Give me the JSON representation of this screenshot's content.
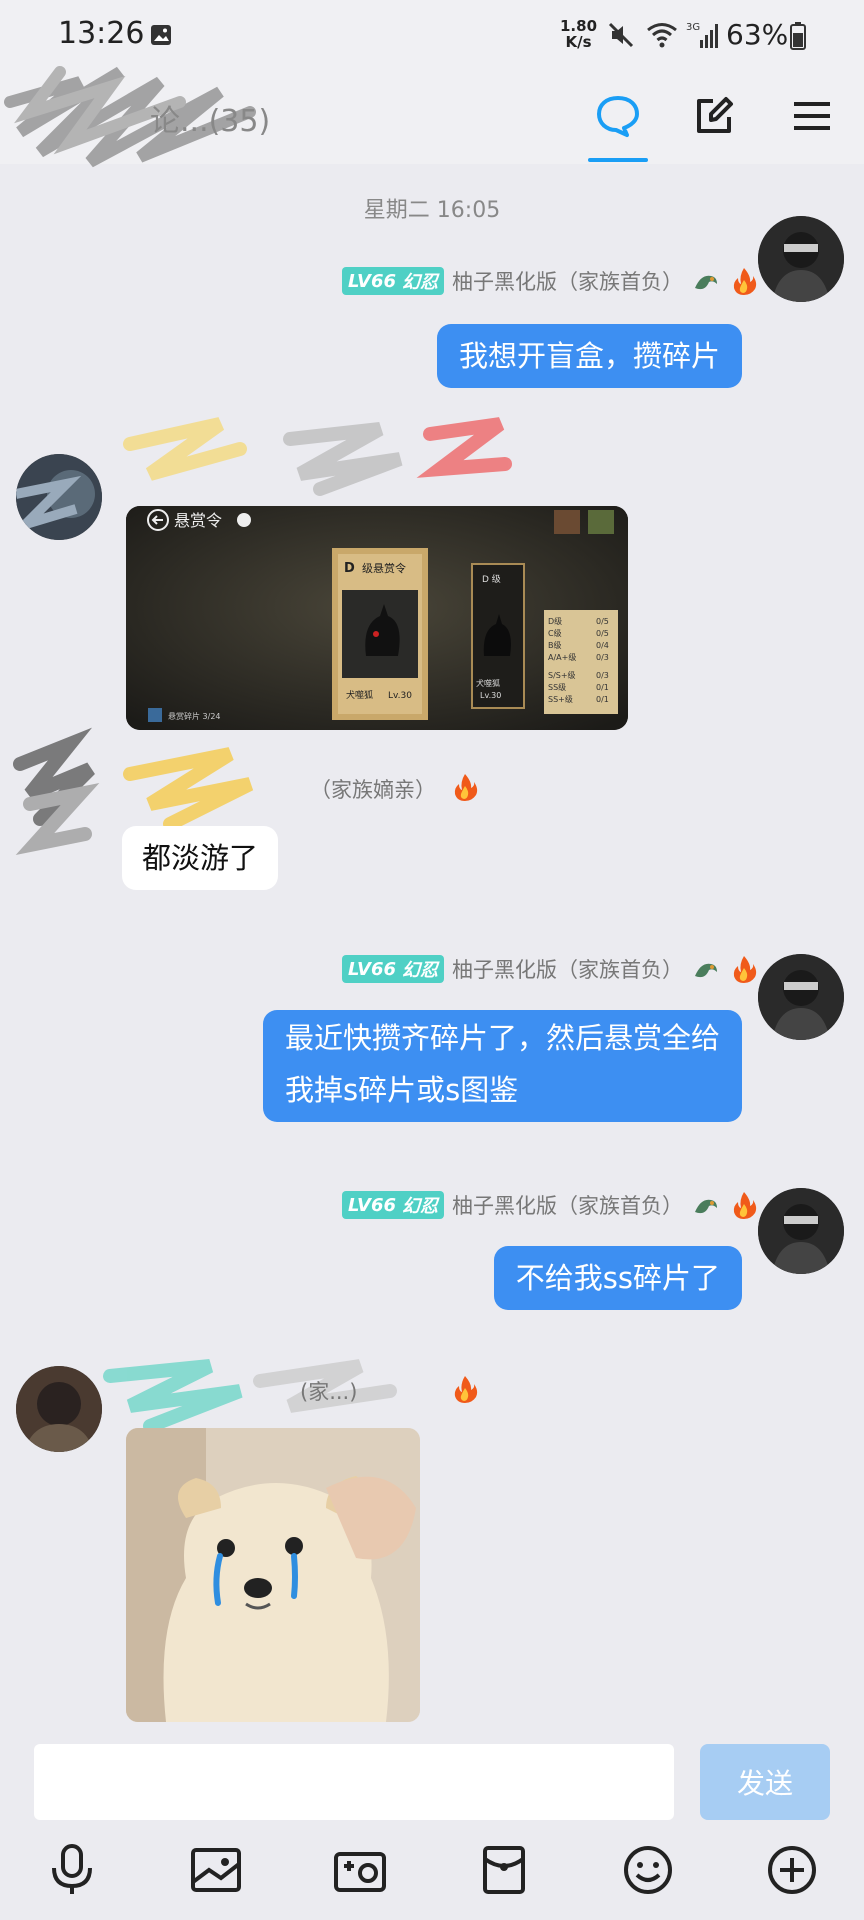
{
  "status_bar": {
    "time": "13:26",
    "net_speed_value": "1.80",
    "net_speed_unit": "K/s",
    "signal_label": "3G",
    "battery": "63%"
  },
  "title_bar": {
    "title": "论...(35)",
    "active_tab": "chat"
  },
  "chat": {
    "timestamp": "星期二 16:05",
    "messages": [
      {
        "side": "right",
        "level": "LV66",
        "rank": "幻忍",
        "sender": "柚子黑化版（家族首负）",
        "text": "我想开盲盒，攒碎片"
      },
      {
        "side": "left",
        "type": "image",
        "image": {
          "title": "悬赏令",
          "card_grade": "D",
          "card_title": "级悬赏令",
          "card_name": "犬噬狐",
          "card_level": "Lv.30",
          "small_card_grade": "D 级",
          "small_card_name": "犬噬狐",
          "small_card_level": "Lv.30",
          "table": [
            {
              "label": "D级",
              "value": "0/5"
            },
            {
              "label": "C级",
              "value": "0/5"
            },
            {
              "label": "B级",
              "value": "0/4"
            },
            {
              "label": "A/A+级",
              "value": "0/3"
            },
            {
              "label": "S/S+级",
              "value": "0/3"
            },
            {
              "label": "SS级",
              "value": "0/1"
            },
            {
              "label": "SS+级",
              "value": "0/1"
            }
          ],
          "footer_left": "悬赏碎片 3/24"
        }
      },
      {
        "side": "left",
        "sender_visible": "（家族嫡亲）",
        "text": "都淡游了"
      },
      {
        "side": "right",
        "level": "LV66",
        "rank": "幻忍",
        "sender": "柚子黑化版（家族首负）",
        "text_line1": "最近快攒齐碎片了，然后悬赏全给",
        "text_line2": "我掉s碎片或s图鉴"
      },
      {
        "side": "right",
        "level": "LV66",
        "rank": "幻忍",
        "sender": "柚子黑化版（家族首负）",
        "text": "不给我ss碎片了"
      },
      {
        "side": "left",
        "type": "image",
        "sender_visible": "(家...)"
      }
    ]
  },
  "input": {
    "placeholder": "",
    "send_label": "发送"
  },
  "colors": {
    "accent": "#1a9ef5",
    "bubble_blue": "#3d8ff2",
    "send_disabled": "#a7cdf3",
    "badge": "#4fd0c5",
    "background": "#ebebf0"
  },
  "icons": {
    "toolbar": [
      "microphone-icon",
      "image-icon",
      "camera-icon",
      "red-packet-icon",
      "emoji-icon",
      "plus-icon"
    ]
  }
}
